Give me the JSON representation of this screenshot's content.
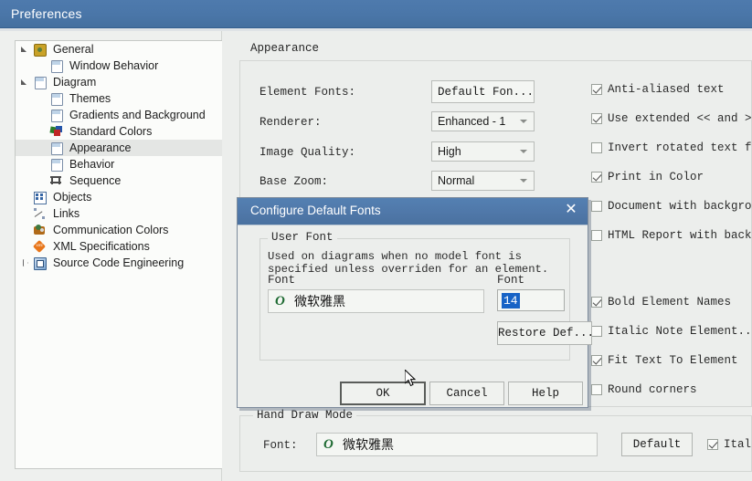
{
  "window": {
    "title": "Preferences"
  },
  "sidebar": {
    "items": [
      {
        "label": "General",
        "icon": "gear-icon",
        "indent": 0,
        "twisty": "open",
        "selected": false
      },
      {
        "label": "Window Behavior",
        "icon": "page-icon",
        "indent": 1,
        "twisty": "none",
        "selected": false
      },
      {
        "label": "Diagram",
        "icon": "page-icon",
        "indent": 0,
        "twisty": "open",
        "selected": false
      },
      {
        "label": "Themes",
        "icon": "page-icon",
        "indent": 1,
        "twisty": "none",
        "selected": false
      },
      {
        "label": "Gradients and Background",
        "icon": "page-icon",
        "indent": 1,
        "twisty": "none",
        "selected": false
      },
      {
        "label": "Standard Colors",
        "icon": "colors-icon",
        "indent": 1,
        "twisty": "none",
        "selected": false
      },
      {
        "label": "Appearance",
        "icon": "page-icon",
        "indent": 1,
        "twisty": "none",
        "selected": true
      },
      {
        "label": "Behavior",
        "icon": "page-icon",
        "indent": 1,
        "twisty": "none",
        "selected": false
      },
      {
        "label": "Sequence",
        "icon": "sequence-icon",
        "indent": 1,
        "twisty": "none",
        "selected": false
      },
      {
        "label": "Objects",
        "icon": "objects-icon",
        "indent": 0,
        "twisty": "none",
        "selected": false
      },
      {
        "label": "Links",
        "icon": "links-icon",
        "indent": 0,
        "twisty": "none",
        "selected": false
      },
      {
        "label": "Communication Colors",
        "icon": "comm-icon",
        "indent": 0,
        "twisty": "none",
        "selected": false
      },
      {
        "label": "XML Specifications",
        "icon": "xml-icon",
        "indent": 0,
        "twisty": "none",
        "selected": false
      },
      {
        "label": "Source Code Engineering",
        "icon": "sce-icon",
        "indent": 0,
        "twisty": "closed",
        "selected": false
      }
    ]
  },
  "main": {
    "heading": "Appearance",
    "fields": [
      {
        "label": "Element Fonts:",
        "value": "Default Fon...",
        "kind": "button"
      },
      {
        "label": "Renderer:",
        "value": "Enhanced - 1",
        "kind": "combo"
      },
      {
        "label": "Image Quality:",
        "value": "High",
        "kind": "combo"
      },
      {
        "label": "Base Zoom:",
        "value": "Normal",
        "kind": "combo"
      }
    ],
    "checkboxes_top": [
      {
        "label": "Anti-aliased text",
        "checked": true
      },
      {
        "label": "Use extended << and >",
        "checked": true
      },
      {
        "label": "Invert rotated text f",
        "checked": false
      },
      {
        "label": "Print in Color",
        "checked": true
      },
      {
        "label": "Document with backgro",
        "checked": false
      },
      {
        "label": "HTML Report with back",
        "checked": false
      }
    ],
    "checkboxes_bottom": [
      {
        "label": "Bold Element Names",
        "checked": true
      },
      {
        "label": "Italic Note Element...",
        "checked": false
      },
      {
        "label": "Fit Text To Element",
        "checked": true
      },
      {
        "label": "Round corners",
        "checked": false
      }
    ],
    "hand_draw": {
      "legend": "Hand Draw Mode",
      "font_label": "Font:",
      "font_value": "微软雅黑",
      "font_icon": "opentype-font-icon",
      "default_button": "Default",
      "italic_checkbox": {
        "label": "Ital",
        "checked": true
      }
    }
  },
  "dialog": {
    "title": "Configure Default Fonts",
    "close_icon": "close-icon",
    "group_legend": "User Font",
    "description": "Used on diagrams when no model font is\nspecified unless overriden for an element.",
    "font_label": "Font",
    "font_value": "微软雅黑",
    "font_icon": "opentype-font-icon",
    "size_label": "Font",
    "size_value": "14",
    "restore_button": "Restore Def...",
    "buttons": {
      "ok": "OK",
      "cancel": "Cancel",
      "help": "Help"
    }
  },
  "colors": {
    "titlebar": "#4a76a8",
    "dialog_header": "#4f77a8",
    "selection": "#1763c6",
    "panel_bg": "#eceeec",
    "tree_bg": "#fbfcfa"
  }
}
